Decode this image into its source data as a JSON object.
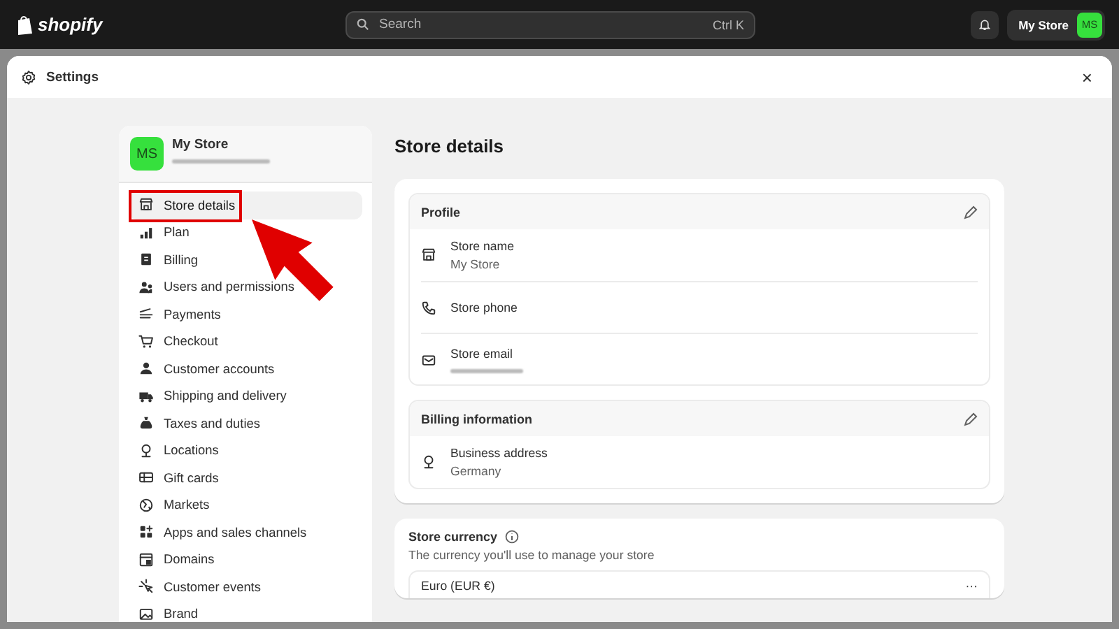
{
  "topbar": {
    "logo": "shopify",
    "search": {
      "placeholder": "Search",
      "shortcut": "Ctrl K"
    },
    "store_button": "My Store",
    "avatar": "MS"
  },
  "window": {
    "title": "Settings",
    "close": "×"
  },
  "sidebar": {
    "store": {
      "avatar": "MS",
      "name": "My Store"
    },
    "items": [
      {
        "label": "Store details",
        "selected": true
      },
      {
        "label": "Plan",
        "selected": false
      },
      {
        "label": "Billing",
        "selected": false
      },
      {
        "label": "Users and permissions",
        "selected": false
      },
      {
        "label": "Payments",
        "selected": false
      },
      {
        "label": "Checkout",
        "selected": false
      },
      {
        "label": "Customer accounts",
        "selected": false
      },
      {
        "label": "Shipping and delivery",
        "selected": false
      },
      {
        "label": "Taxes and duties",
        "selected": false
      },
      {
        "label": "Locations",
        "selected": false
      },
      {
        "label": "Gift cards",
        "selected": false
      },
      {
        "label": "Markets",
        "selected": false
      },
      {
        "label": "Apps and sales channels",
        "selected": false
      },
      {
        "label": "Domains",
        "selected": false
      },
      {
        "label": "Customer events",
        "selected": false
      },
      {
        "label": "Brand",
        "selected": false
      }
    ]
  },
  "content": {
    "title": "Store details",
    "sections": [
      {
        "title": "Profile",
        "rows": [
          {
            "label": "Store name",
            "value": "My Store"
          },
          {
            "label": "Store phone"
          },
          {
            "label": "Store email",
            "redacted": true
          }
        ]
      },
      {
        "title": "Billing information",
        "rows": [
          {
            "label": "Business address",
            "value": "Germany"
          }
        ]
      }
    ],
    "currency": {
      "title": "Store currency",
      "description": "The currency you'll use to manage your store",
      "value": "Euro (EUR €)",
      "menu": "···"
    }
  }
}
